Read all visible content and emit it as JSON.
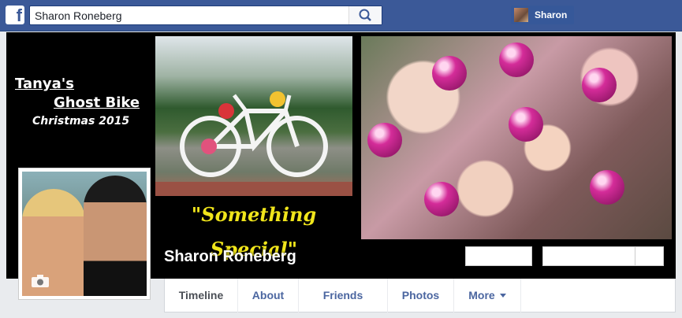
{
  "topbar": {
    "logo_letter": "f",
    "search_value": "Sharon Roneberg",
    "user_name": "Sharon"
  },
  "cover": {
    "title_line1": "Tanya's",
    "title_line2": "Ghost Bike",
    "title_line3": "Christmas 2015",
    "tagline": "\"Something Special\"",
    "profile_name": "Sharon Roneberg"
  },
  "nav": {
    "tabs": [
      "Timeline",
      "About",
      "Friends",
      "Photos",
      "More"
    ]
  },
  "colors": {
    "brand": "#3b5998",
    "tagline": "#f0e51b",
    "ornament": "#d42c99"
  }
}
